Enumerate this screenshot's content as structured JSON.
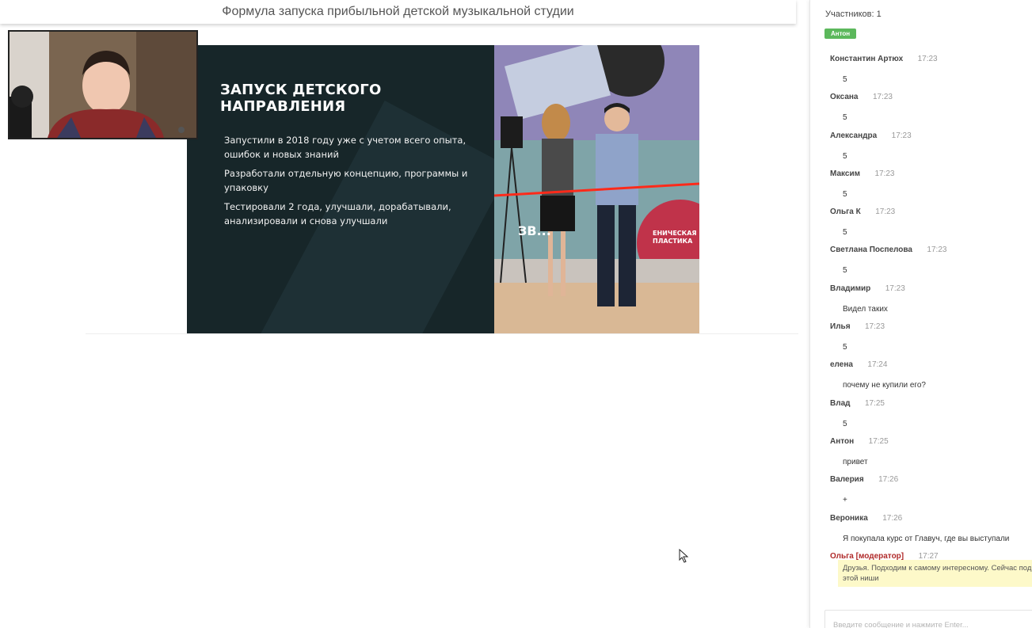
{
  "header": {
    "title": "Формула запуска прибыльной детской музыкальной студии"
  },
  "slide": {
    "heading": "ЗАПУСК ДЕТСКОГО НАПРАВЛЕНИЯ",
    "points": [
      "Запустили в 2018 году уже с учетом всего опыта, ошибок и новых знаний",
      "Разработали отдельную концепцию, программы и упаковку",
      "Тестировали 2 года, улучшали, дорабатывали, анализировали и снова улучшали"
    ],
    "photo_caption": "ЗВ...",
    "photo_sign": "ЕНИЧЕСКАЯ\nПЛАСТИКА"
  },
  "sidebar": {
    "participants": "Участников: 1",
    "badge": "Антон",
    "messages": [
      {
        "name": "Константин Артюх",
        "time": "17:23",
        "text": "5"
      },
      {
        "name": "Оксана",
        "time": "17:23",
        "text": "5"
      },
      {
        "name": "Александра",
        "time": "17:23",
        "text": "5"
      },
      {
        "name": "Максим",
        "time": "17:23",
        "text": "5"
      },
      {
        "name": "Ольга К",
        "time": "17:23",
        "text": "5"
      },
      {
        "name": "Светлана Поспелова",
        "time": "17:23",
        "text": "5"
      },
      {
        "name": "Владимир",
        "time": "17:23",
        "text": "Видел таких"
      },
      {
        "name": "Илья",
        "time": "17:23",
        "text": "5"
      },
      {
        "name": "елена",
        "time": "17:24",
        "text": "почему не купили его?"
      },
      {
        "name": "Влад",
        "time": "17:25",
        "text": "5"
      },
      {
        "name": "Антон",
        "time": "17:25",
        "text": "привет"
      },
      {
        "name": "Валерия",
        "time": "17:26",
        "text": "+"
      },
      {
        "name": "Вероника",
        "time": "17:26",
        "text": "Я покупала курс от Главуч, где вы выступали"
      }
    ],
    "moderator_message": {
      "name": "Ольга [модератор]",
      "time": "17:27",
      "line1": "Друзья. Подходим к самому интересному. Сейчас под",
      "line2": "этой ниши"
    },
    "input_placeholder": "Введите сообщение и нажмите Enter..."
  },
  "colors": {
    "slide_bg": "#172629",
    "badge_green": "#5cb85c",
    "moderator_red": "#b02a2a",
    "highlight_yellow": "#fdf9c9"
  }
}
